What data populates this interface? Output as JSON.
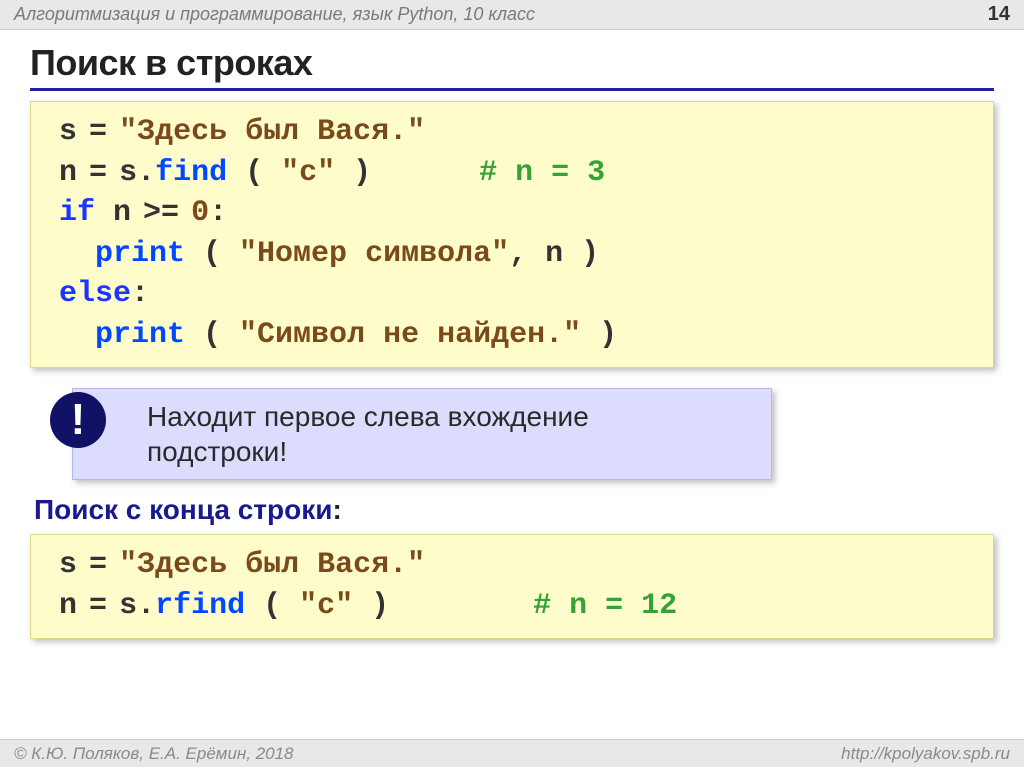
{
  "header": {
    "breadcrumb": "Алгоритмизация и программирование, язык Python, 10 класс",
    "page_number": "14"
  },
  "title": "Поиск в строках",
  "code1": {
    "l1a": "s",
    "l1b": "=",
    "l1c": "\"Здесь был Вася.\"",
    "l2a": "n",
    "l2b": "=",
    "l2c": "s.",
    "l2d": "find",
    "l2e": " ( ",
    "l2f": "\"с\"",
    "l2g": " )      ",
    "l2h": "# n = 3",
    "l3a": "if",
    "l3b": " n",
    "l3c": ">=",
    "l3d": "0",
    "l3e": ":",
    "l4a": "  ",
    "l4b": "print",
    "l4c": " ( ",
    "l4d": "\"Номер символа\"",
    "l4e": ", n )",
    "l5a": "else",
    "l5b": ":",
    "l6a": "  ",
    "l6b": "print",
    "l6c": " ( ",
    "l6d": "\"Символ не найден.\"",
    "l6e": " )"
  },
  "callout": {
    "mark": "!",
    "line1": " Находит первое слева вхождение",
    "line2": "подстроки!"
  },
  "subhead": {
    "text": "Поиск с конца строки",
    "colon": ":"
  },
  "code2": {
    "l1a": "s",
    "l1b": "=",
    "l1c": "\"Здесь был Вася.\"",
    "l2a": "n",
    "l2b": "=",
    "l2c": "s.",
    "l2d": "rfind",
    "l2e": " ( ",
    "l2f": "\"с\"",
    "l2g": " )        ",
    "l2h": "# n = 12"
  },
  "footer": {
    "copyright": "© К.Ю. Поляков, Е.А. Ерёмин, 2018",
    "url": "http://kpolyakov.spb.ru"
  }
}
